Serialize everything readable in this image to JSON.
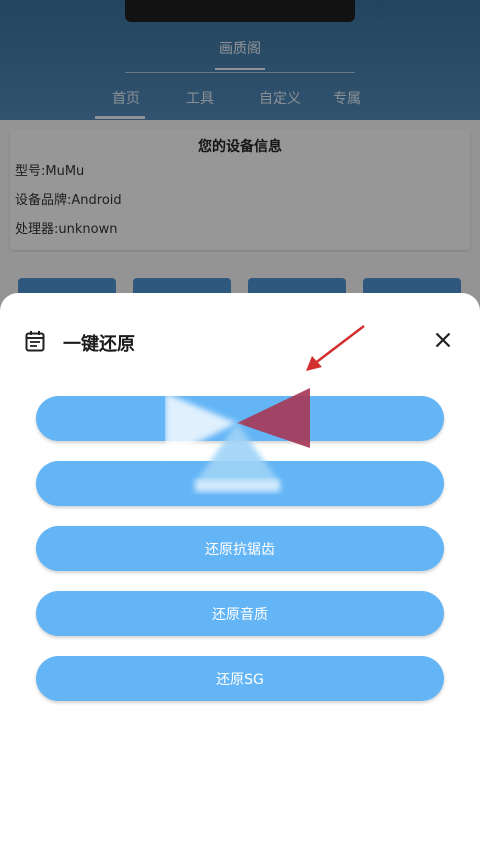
{
  "app": {
    "title": "画质阁",
    "tabs": [
      {
        "label": "首页"
      },
      {
        "label": "工具"
      },
      {
        "label": "自定义"
      },
      {
        "label": "专属"
      }
    ]
  },
  "device_info": {
    "heading": "您的设备信息",
    "model": "型号:MuMu",
    "brand": "设备品牌:Android",
    "processor": "处理器:unknown"
  },
  "sheet": {
    "title": "一键还原",
    "icon": "calendar-icon",
    "close_icon": "close-icon",
    "buttons": [
      {
        "label": ""
      },
      {
        "label": ""
      },
      {
        "label": "还原抗锯齿"
      },
      {
        "label": "还原音质"
      },
      {
        "label": "还原SG"
      }
    ]
  },
  "colors": {
    "header": "#4a7fab",
    "button": "#64b5f6",
    "arrow": "#d32f2f"
  }
}
